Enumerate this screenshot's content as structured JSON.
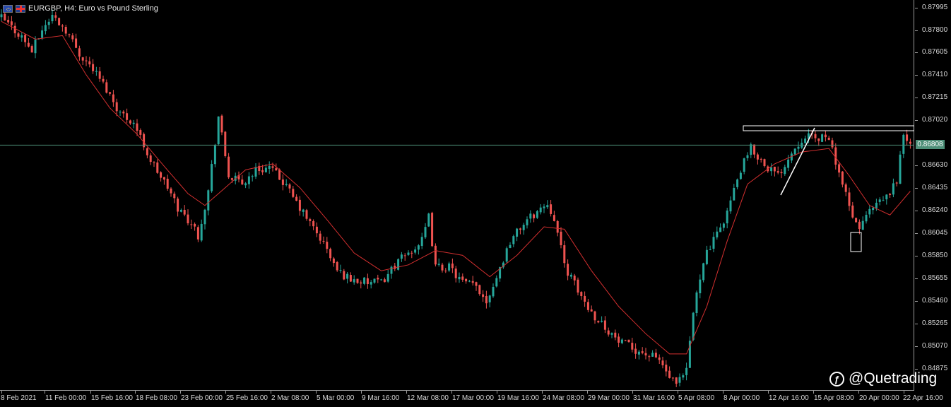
{
  "window": {
    "symbol_title": "EURGBP, H4:  Euro vs Pound Sterling",
    "flag_icons": [
      "eu-flag-icon",
      "gb-flag-icon"
    ]
  },
  "price_axis": {
    "labels": [
      "0.87995",
      "0.87800",
      "0.87605",
      "0.87410",
      "0.87215",
      "0.87020",
      "0.86630",
      "0.86435",
      "0.86240",
      "0.86045",
      "0.85850",
      "0.85655",
      "0.85460",
      "0.85265",
      "0.85070",
      "0.84875"
    ],
    "current_price": "0.86808",
    "current_price_color": "#4d8f78"
  },
  "time_axis": {
    "labels": [
      "8 Feb 2021",
      "11 Feb 00:00",
      "15 Feb 16:00",
      "18 Feb 08:00",
      "23 Feb 00:00",
      "25 Feb 16:00",
      "2 Mar 08:00",
      "5 Mar 00:00",
      "9 Mar 16:00",
      "12 Mar 08:00",
      "17 Mar 00:00",
      "19 Mar 16:00",
      "24 Mar 08:00",
      "29 Mar 00:00",
      "31 Mar 16:00",
      "5 Apr 08:00",
      "8 Apr 00:00",
      "12 Apr 16:00",
      "15 Apr 08:00",
      "20 Apr 00:00",
      "22 Apr 16:00"
    ]
  },
  "watermark": {
    "text": "@Quetrading",
    "icon": "quetrading-logo-icon"
  },
  "chart_data": {
    "type": "candlestick",
    "symbol": "EURGBP",
    "timeframe": "H4",
    "ylim": [
      0.8474,
      0.8803
    ],
    "grid": false,
    "colors": {
      "background": "#000000",
      "bull": "#26a69a",
      "bear": "#ef5350",
      "moving_average": "#d32f2f",
      "current_price_line": "#4d8f78",
      "drawings": "#ffffff"
    },
    "close_path": [
      [
        0,
        0.8788
      ],
      [
        6,
        0.8772
      ],
      [
        9,
        0.876
      ],
      [
        12,
        0.8778
      ],
      [
        15,
        0.879
      ],
      [
        19,
        0.8778
      ],
      [
        23,
        0.8758
      ],
      [
        27,
        0.8745
      ],
      [
        31,
        0.8728
      ],
      [
        35,
        0.8708
      ],
      [
        39,
        0.87
      ],
      [
        44,
        0.8668
      ],
      [
        49,
        0.8645
      ],
      [
        52,
        0.8628
      ],
      [
        56,
        0.8615
      ],
      [
        58,
        0.8605
      ],
      [
        61,
        0.8642
      ],
      [
        64,
        0.8705
      ],
      [
        67,
        0.8655
      ],
      [
        71,
        0.8648
      ],
      [
        75,
        0.866
      ],
      [
        79,
        0.8662
      ],
      [
        83,
        0.865
      ],
      [
        87,
        0.8632
      ],
      [
        91,
        0.8615
      ],
      [
        95,
        0.8598
      ],
      [
        99,
        0.8575
      ],
      [
        103,
        0.8568
      ],
      [
        108,
        0.8565
      ],
      [
        112,
        0.8565
      ],
      [
        116,
        0.858
      ],
      [
        120,
        0.859
      ],
      [
        124,
        0.86
      ],
      [
        126,
        0.862
      ],
      [
        128,
        0.8578
      ],
      [
        132,
        0.8578
      ],
      [
        136,
        0.8565
      ],
      [
        140,
        0.8562
      ],
      [
        143,
        0.855
      ],
      [
        146,
        0.857
      ],
      [
        150,
        0.86
      ],
      [
        154,
        0.8615
      ],
      [
        158,
        0.8625
      ],
      [
        161,
        0.8632
      ],
      [
        163,
        0.862
      ],
      [
        166,
        0.858
      ],
      [
        170,
        0.8558
      ],
      [
        174,
        0.854
      ],
      [
        178,
        0.8528
      ],
      [
        182,
        0.8515
      ],
      [
        186,
        0.851
      ],
      [
        190,
        0.8505
      ],
      [
        194,
        0.85
      ],
      [
        197,
        0.8485
      ],
      [
        199,
        0.8478
      ],
      [
        202,
        0.849
      ],
      [
        204,
        0.854
      ],
      [
        207,
        0.8585
      ],
      [
        211,
        0.8605
      ],
      [
        214,
        0.8625
      ],
      [
        218,
        0.866
      ],
      [
        221,
        0.8678
      ],
      [
        225,
        0.8665
      ],
      [
        229,
        0.8655
      ],
      [
        233,
        0.8675
      ],
      [
        237,
        0.869
      ],
      [
        240,
        0.8685
      ],
      [
        243,
        0.869
      ],
      [
        246,
        0.8668
      ],
      [
        249,
        0.8638
      ],
      [
        251,
        0.8618
      ],
      [
        253,
        0.8612
      ],
      [
        256,
        0.8625
      ],
      [
        259,
        0.8632
      ],
      [
        262,
        0.864
      ],
      [
        264,
        0.8652
      ],
      [
        266,
        0.869
      ],
      [
        268,
        0.868
      ]
    ],
    "ma_path": [
      [
        0,
        0.8785
      ],
      [
        10,
        0.877
      ],
      [
        18,
        0.8773
      ],
      [
        25,
        0.874
      ],
      [
        32,
        0.8712
      ],
      [
        40,
        0.869
      ],
      [
        48,
        0.8663
      ],
      [
        55,
        0.864
      ],
      [
        60,
        0.863
      ],
      [
        66,
        0.8645
      ],
      [
        72,
        0.866
      ],
      [
        80,
        0.8665
      ],
      [
        88,
        0.8645
      ],
      [
        96,
        0.8618
      ],
      [
        104,
        0.859
      ],
      [
        112,
        0.8575
      ],
      [
        120,
        0.858
      ],
      [
        128,
        0.8592
      ],
      [
        136,
        0.8588
      ],
      [
        144,
        0.857
      ],
      [
        152,
        0.8588
      ],
      [
        160,
        0.8612
      ],
      [
        166,
        0.861
      ],
      [
        174,
        0.8575
      ],
      [
        182,
        0.8545
      ],
      [
        190,
        0.8522
      ],
      [
        197,
        0.8505
      ],
      [
        202,
        0.8505
      ],
      [
        208,
        0.8545
      ],
      [
        214,
        0.86
      ],
      [
        220,
        0.8648
      ],
      [
        228,
        0.8665
      ],
      [
        236,
        0.8675
      ],
      [
        244,
        0.8678
      ],
      [
        250,
        0.8655
      ],
      [
        256,
        0.863
      ],
      [
        262,
        0.8622
      ],
      [
        268,
        0.8642
      ]
    ]
  }
}
